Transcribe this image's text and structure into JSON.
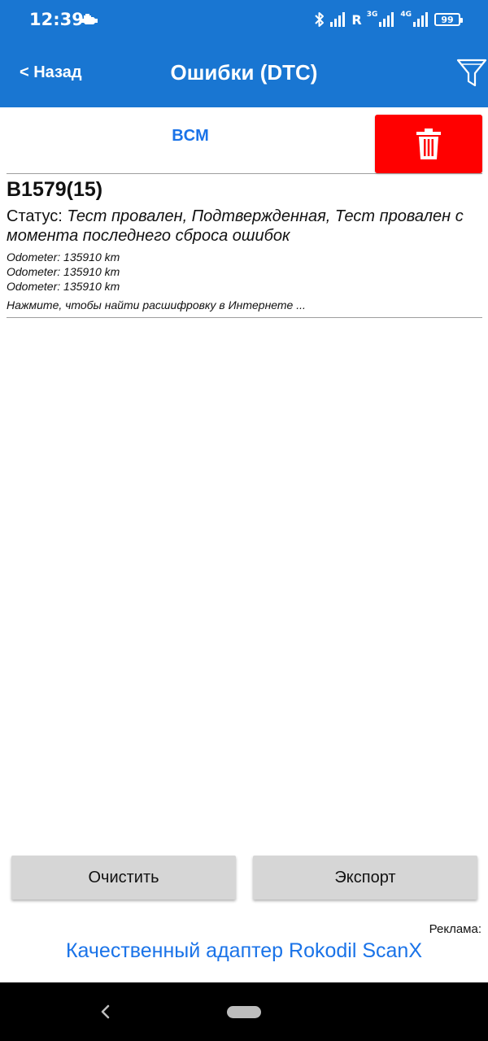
{
  "status_bar": {
    "time": "12:39",
    "network_label": "R",
    "network_small_1": "3G",
    "network_small_2": "4G",
    "battery": "99"
  },
  "header": {
    "back_label": "< Назад",
    "title": "Ошибки (DTC)",
    "color": "#1976d2"
  },
  "module": {
    "name": "BCM",
    "delete_color": "#ff0000"
  },
  "error": {
    "code": "B1579(15)",
    "status_label": "Статус: ",
    "status_value": "Тест провален, Подтвержденная, Тест провален с момента последнего сброса ошибок",
    "odometer": [
      "Odometer: 135910 km",
      "Odometer: 135910 km",
      "Odometer: 135910 km"
    ],
    "search_hint": "Нажмите, чтобы найти расшифровку в Интернете ..."
  },
  "buttons": {
    "clear": "Очистить",
    "export": "Экспорт"
  },
  "ad": {
    "label": "Реклама:",
    "link": "Качественный адаптер Rokodil ScanX",
    "link_color": "#1a73e8"
  },
  "icons": {
    "engine": "engine-icon",
    "bluetooth": "bluetooth-icon",
    "signal": "signal-icon",
    "battery": "battery-icon",
    "filter": "filter-icon",
    "trash": "trash-icon",
    "nav_back": "nav-back-icon",
    "nav_home": "nav-home-pill"
  }
}
